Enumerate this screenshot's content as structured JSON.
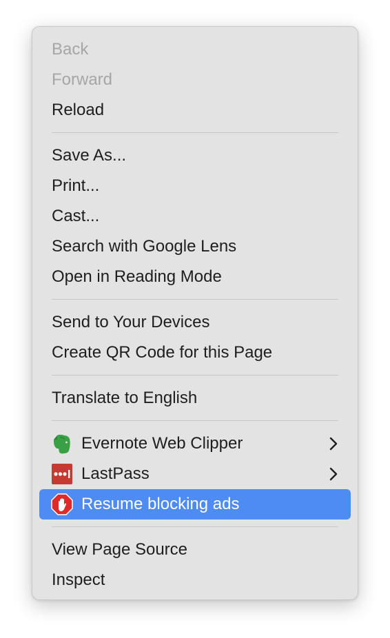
{
  "menu": {
    "groups": [
      {
        "items": [
          {
            "label": "Back",
            "disabled": true
          },
          {
            "label": "Forward",
            "disabled": true
          },
          {
            "label": "Reload",
            "disabled": false
          }
        ]
      },
      {
        "items": [
          {
            "label": "Save As..."
          },
          {
            "label": "Print..."
          },
          {
            "label": "Cast..."
          },
          {
            "label": "Search with Google Lens"
          },
          {
            "label": "Open in Reading Mode"
          }
        ]
      },
      {
        "items": [
          {
            "label": "Send to Your Devices"
          },
          {
            "label": "Create QR Code for this Page"
          }
        ]
      },
      {
        "items": [
          {
            "label": "Translate to English"
          }
        ]
      },
      {
        "items": [
          {
            "label": "Evernote Web Clipper",
            "icon": "evernote-elephant-icon",
            "has_submenu": true
          },
          {
            "label": "LastPass",
            "icon": "lastpass-dots-icon",
            "has_submenu": true
          },
          {
            "label": "Resume blocking ads",
            "icon": "stop-hand-icon",
            "highlighted": true
          }
        ]
      },
      {
        "items": [
          {
            "label": "View Page Source"
          },
          {
            "label": "Inspect"
          }
        ]
      }
    ]
  },
  "colors": {
    "highlight": "#4e8bf2",
    "evernote_green": "#3aa045",
    "lastpass_red": "#c63b31",
    "adblock_red": "#e02a2a"
  }
}
